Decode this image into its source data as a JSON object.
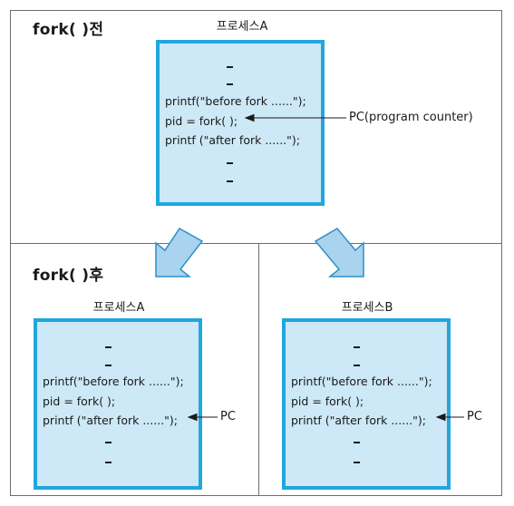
{
  "before": {
    "label": "fork(   )전",
    "process_title": "프로세스A",
    "code_lines": [
      "printf(\"before fork ......\");",
      "pid = fork( );",
      "printf (\"after fork ......\");"
    ],
    "pc_label": "PC(program counter)"
  },
  "after": {
    "label": "fork(   )후",
    "process_a": {
      "title": "프로세스A",
      "code_lines": [
        "printf(\"before fork ......\");",
        "pid = fork( );",
        "printf (\"after fork ......\");"
      ],
      "pc_label": "PC"
    },
    "process_b": {
      "title": "프로세스B",
      "code_lines": [
        "printf(\"before fork ......\");",
        "pid = fork( );",
        "printf (\"after fork ......\");"
      ],
      "pc_label": "PC"
    }
  },
  "colors": {
    "process_fill": "#cde8f6",
    "process_border": "#21a6dd",
    "arrow_fill": "#a9d3ee",
    "arrow_stroke": "#2e8fc8"
  }
}
